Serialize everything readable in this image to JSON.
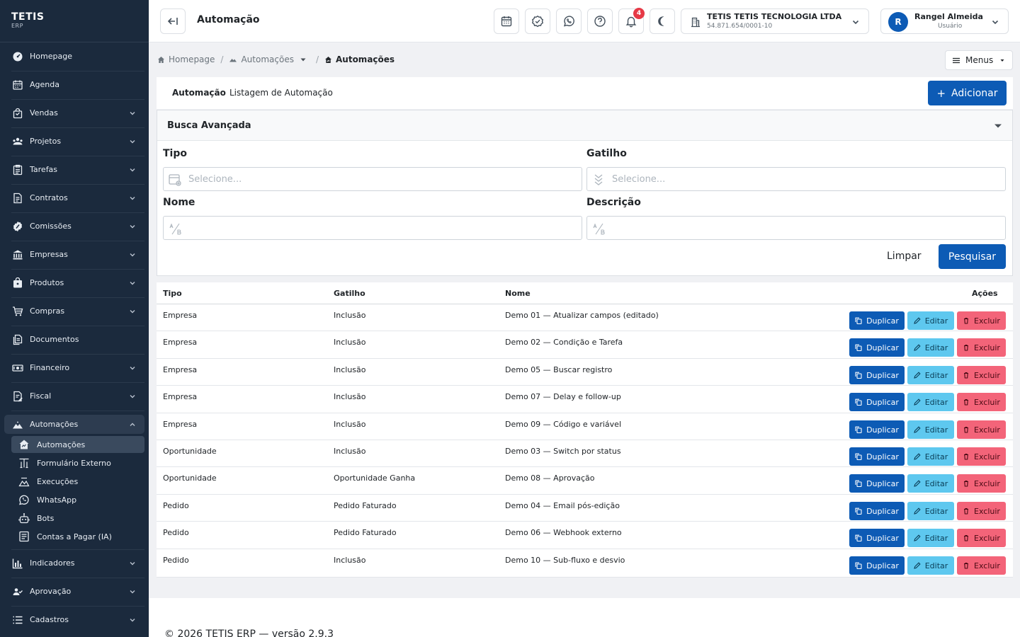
{
  "brand": {
    "name": "TETIS",
    "sub": "ERP"
  },
  "sidebar": {
    "items": [
      {
        "label": "Homepage",
        "icon": "dashboard-icon",
        "chevron": false
      },
      {
        "label": "Agenda",
        "icon": "calendar-icon",
        "chevron": false
      },
      {
        "label": "Vendas",
        "icon": "shopping-bag-icon",
        "chevron": true
      },
      {
        "label": "Projetos",
        "icon": "projects-icon",
        "chevron": true
      },
      {
        "label": "Tarefas",
        "icon": "tasks-icon",
        "chevron": true
      },
      {
        "label": "Contratos",
        "icon": "contract-icon",
        "chevron": true
      },
      {
        "label": "Comissões",
        "icon": "badge-icon",
        "chevron": true
      },
      {
        "label": "Empresas",
        "icon": "bank-icon",
        "chevron": true
      },
      {
        "label": "Produtos",
        "icon": "package-icon",
        "chevron": true
      },
      {
        "label": "Compras",
        "icon": "cart-icon",
        "chevron": true
      },
      {
        "label": "Documentos",
        "icon": "documents-icon",
        "chevron": false
      },
      {
        "label": "Financeiro",
        "icon": "money-icon",
        "chevron": true
      },
      {
        "label": "Fiscal",
        "icon": "fiscal-icon",
        "chevron": true
      },
      {
        "label": "Automações",
        "icon": "automation-icon",
        "chevron": true
      },
      {
        "label": "Indicadores",
        "icon": "chart-icon",
        "chevron": true
      },
      {
        "label": "Aprovação",
        "icon": "users-icon",
        "chevron": true
      },
      {
        "label": "Cadastros",
        "icon": "list-icon",
        "chevron": true
      }
    ],
    "subitems": [
      {
        "label": "Automações",
        "icon": "automation-home-icon",
        "active": true
      },
      {
        "label": "Formulário Externo",
        "icon": "form-icon",
        "active": false
      },
      {
        "label": "Execuções",
        "icon": "executions-icon",
        "active": false
      },
      {
        "label": "WhatsApp",
        "icon": "whatsapp-icon",
        "active": false
      },
      {
        "label": "Bots",
        "icon": "robot-icon",
        "active": false
      },
      {
        "label": "Contas a Pagar (IA)",
        "icon": "receipt-icon",
        "active": false
      }
    ]
  },
  "topbar": {
    "title": "Automação",
    "notification_count": "4",
    "company": {
      "name": "TETIS TETIS TECNOLOGIA LTDA",
      "cnpj": "54.871.654/0001-10"
    },
    "user": {
      "initial": "R",
      "name": "Rangel Almeida",
      "role": "Usuário"
    }
  },
  "breadcrumb": {
    "home": "Homepage",
    "parent": "Automações",
    "current": "Automações"
  },
  "menus_label": "Menus",
  "header": {
    "title": "Automação",
    "subtitle": "Listagem de Automação",
    "add_label": "Adicionar"
  },
  "search": {
    "title": "Busca Avançada",
    "tipo": {
      "label": "Tipo",
      "placeholder": "Selecione..."
    },
    "gatilho": {
      "label": "Gatilho",
      "placeholder": "Selecione..."
    },
    "nome": {
      "label": "Nome",
      "placeholder": ""
    },
    "descricao": {
      "label": "Descrição",
      "placeholder": ""
    },
    "clear_label": "Limpar",
    "search_label": "Pesquisar"
  },
  "table": {
    "headers": {
      "tipo": "Tipo",
      "gatilho": "Gatilho",
      "nome": "Nome",
      "acoes": "Ações"
    },
    "action_labels": {
      "duplicate": "Duplicar",
      "edit": "Editar",
      "delete": "Excluir"
    },
    "rows": [
      {
        "tipo": "Empresa",
        "gatilho": "Inclusão",
        "nome": "Demo 01 — Atualizar campos (editado)"
      },
      {
        "tipo": "Empresa",
        "gatilho": "Inclusão",
        "nome": "Demo 02 — Condição e Tarefa"
      },
      {
        "tipo": "Empresa",
        "gatilho": "Inclusão",
        "nome": "Demo 05 — Buscar registro"
      },
      {
        "tipo": "Empresa",
        "gatilho": "Inclusão",
        "nome": "Demo 07 — Delay e follow-up"
      },
      {
        "tipo": "Empresa",
        "gatilho": "Inclusão",
        "nome": "Demo 09 — Código e variável"
      },
      {
        "tipo": "Oportunidade",
        "gatilho": "Inclusão",
        "nome": "Demo 03 — Switch por status"
      },
      {
        "tipo": "Oportunidade",
        "gatilho": "Oportunidade Ganha",
        "nome": "Demo 08 — Aprovação"
      },
      {
        "tipo": "Pedido",
        "gatilho": "Pedido Faturado",
        "nome": "Demo 04 — Email pós-edição"
      },
      {
        "tipo": "Pedido",
        "gatilho": "Pedido Faturado",
        "nome": "Demo 06 — Webhook externo"
      },
      {
        "tipo": "Pedido",
        "gatilho": "Inclusão",
        "nome": "Demo 10 — Sub-fluxo e desvio"
      }
    ]
  },
  "footer": {
    "text": "© 2026 TETIS ERP — versão 2.9.3"
  },
  "colors": {
    "sidebar": "#1b2a3d",
    "primary": "#0d5bb5",
    "info": "#5ec8ef",
    "danger": "#f36479"
  }
}
